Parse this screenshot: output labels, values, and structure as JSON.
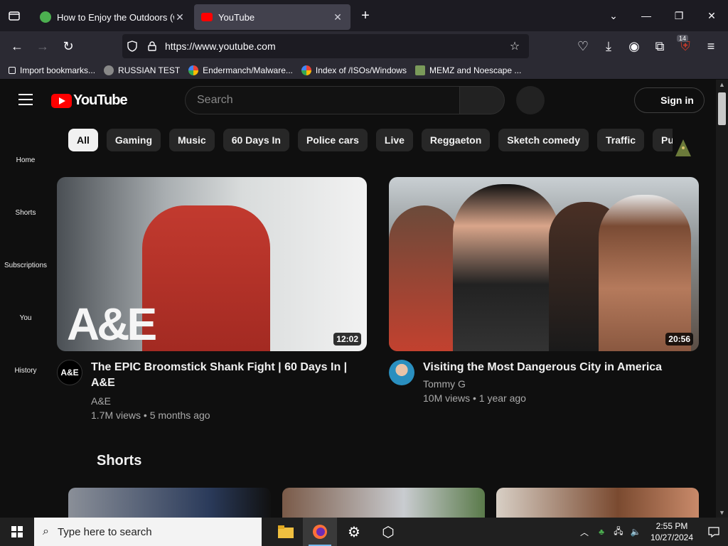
{
  "browser": {
    "tabs": [
      {
        "title": "How to Enjoy the Outdoors (wit",
        "active": false,
        "favicon_color": "#4caf50"
      },
      {
        "title": "YouTube",
        "active": true,
        "favicon_color": "#ff0000"
      }
    ],
    "url": "https://www.youtube.com",
    "extension_badge": "14",
    "bookmarks": [
      {
        "label": "Import bookmarks...",
        "icon": "import-icon"
      },
      {
        "label": "RUSSIAN TEST",
        "icon": "skull-icon"
      },
      {
        "label": "Endermanch/Malware...",
        "icon": "google-icon"
      },
      {
        "label": "Index of /ISOs/Windows",
        "icon": "google-icon"
      },
      {
        "label": "MEMZ and Noescape ...",
        "icon": "image-icon"
      }
    ]
  },
  "youtube": {
    "logo_text": "YouTube",
    "search_placeholder": "Search",
    "sign_in": "Sign in",
    "chips": [
      "All",
      "Gaming",
      "Music",
      "60 Days In",
      "Police cars",
      "Live",
      "Reggaeton",
      "Sketch comedy",
      "Traffic",
      "Punch"
    ],
    "sidebar": [
      "Home",
      "Shorts",
      "Subscriptions",
      "You",
      "History"
    ],
    "videos": [
      {
        "title": "The EPIC Broomstick Shank Fight | 60 Days In | A&E",
        "channel": "A&E",
        "stats": "1.7M views • 5 months ago",
        "duration": "12:02",
        "thumb_overlay": "A&E"
      },
      {
        "title": "Visiting the Most Dangerous City in America",
        "channel": "Tommy G",
        "stats": "10M views • 1 year ago",
        "duration": "20:56"
      }
    ],
    "shorts_heading": "Shorts"
  },
  "taskbar": {
    "search_placeholder": "Type here to search",
    "time": "2:55 PM",
    "date": "10/27/2024"
  }
}
